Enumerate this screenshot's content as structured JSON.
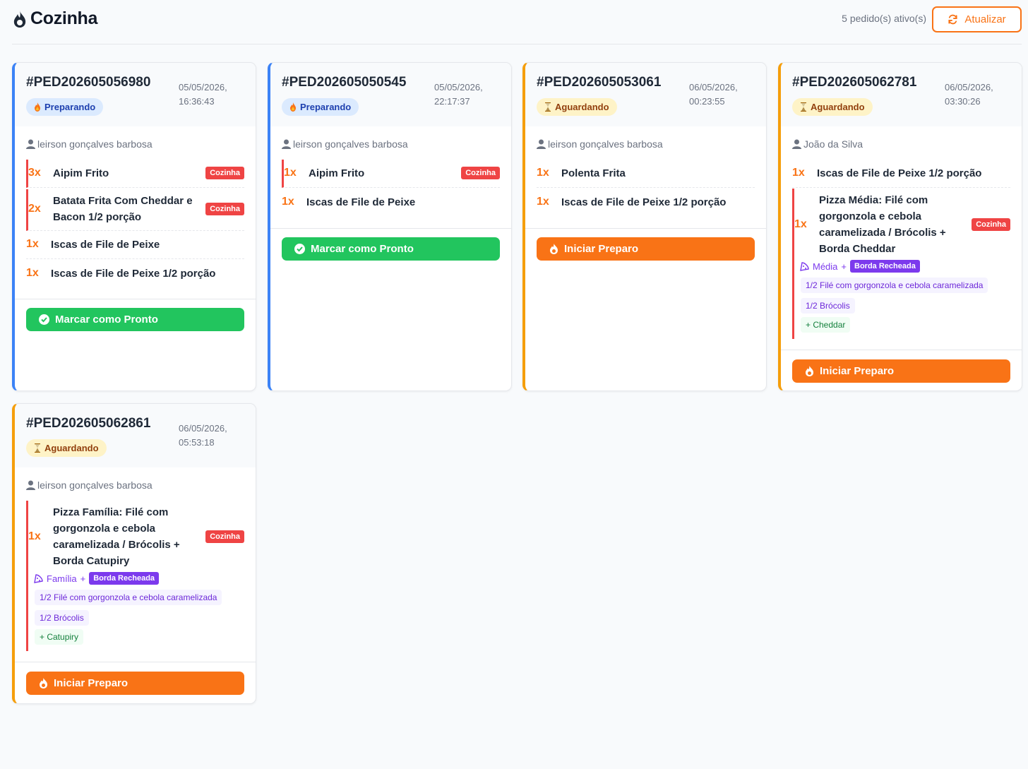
{
  "header": {
    "title": "Cozinha",
    "active_count": "5 pedido(s) ativo(s)",
    "refresh_label": "Atualizar"
  },
  "labels": {
    "kitchen": "Cozinha",
    "ready": "Marcar como Pronto",
    "start": "Iniciar Preparo",
    "borda": "Borda Recheada",
    "plus": "+"
  },
  "colors": {
    "preparing_accent": "#3b82f6",
    "waiting_accent": "#f59e0b",
    "kitchen_badge": "#ef4444",
    "ready_button": "#22c55e",
    "start_button": "#f97316"
  },
  "orders": [
    {
      "id": "#PED202605056980",
      "date": "05/05/2026,",
      "time": "16:36:43",
      "status": "Preparando",
      "customer": "leirson gonçalves barbosa",
      "items": [
        {
          "qty": "3x",
          "name": "Aipim Frito"
        },
        {
          "qty": "2x",
          "name": "Batata Frita Com Cheddar e Bacon 1/2 porção"
        },
        {
          "qty": "1x",
          "name": "Iscas de File de Peixe"
        },
        {
          "qty": "1x",
          "name": "Iscas de File de Peixe 1/2 porção"
        }
      ]
    },
    {
      "id": "#PED202605050545",
      "date": "05/05/2026,",
      "time": "22:17:37",
      "status": "Preparando",
      "customer": "leirson gonçalves barbosa",
      "items": [
        {
          "qty": "1x",
          "name": "Aipim Frito"
        },
        {
          "qty": "1x",
          "name": "Iscas de File de Peixe"
        }
      ]
    },
    {
      "id": "#PED202605053061",
      "date": "06/05/2026,",
      "time": "00:23:55",
      "status": "Aguardando",
      "customer": "leirson gonçalves barbosa",
      "items": [
        {
          "qty": "1x",
          "name": "Polenta Frita"
        },
        {
          "qty": "1x",
          "name": "Iscas de File de Peixe 1/2 porção"
        }
      ]
    },
    {
      "id": "#PED202605062781",
      "date": "06/05/2026,",
      "time": "03:30:26",
      "status": "Aguardando",
      "customer": "João da Silva",
      "items": [
        {
          "qty": "1x",
          "name": "Iscas de File de Peixe 1/2 porção"
        },
        {
          "qty": "1x",
          "name": "Pizza Média: Filé com gorgonzola e cebola caramelizada / Brócolis + Borda Cheddar",
          "size": "Média",
          "flavors": [
            "1/2 Filé com gorgonzola e cebola caramelizada",
            "1/2 Brócolis"
          ],
          "extra": "+ Cheddar"
        }
      ]
    },
    {
      "id": "#PED202605062861",
      "date": "06/05/2026,",
      "time": "05:53:18",
      "status": "Aguardando",
      "customer": "leirson gonçalves barbosa",
      "items": [
        {
          "qty": "1x",
          "name": "Pizza Família: Filé com gorgonzola e cebola caramelizada / Brócolis + Borda Catupiry",
          "size": "Família",
          "flavors": [
            "1/2 Filé com gorgonzola e cebola caramelizada",
            "1/2 Brócolis"
          ],
          "extra": "+ Catupiry"
        }
      ]
    }
  ]
}
